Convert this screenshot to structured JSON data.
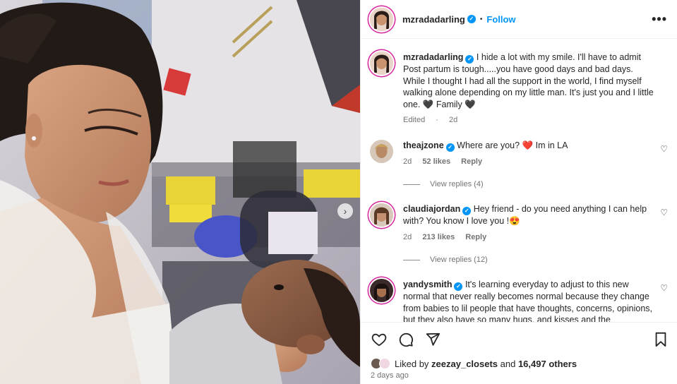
{
  "post": {
    "username": "mzradadarling",
    "follow_label": "Follow",
    "more_label": "•••",
    "dot": "•",
    "next_arrow": "›"
  },
  "caption": {
    "username": "mzradadarling",
    "text_before_heart": "I hide a lot with my smile. I'll have to admit Post partum is tough.....you have good days and bad days. While I thought I had all the support in the world, I find myself walking alone depending on my little man. It's just you and I little one.",
    "heart1": "🖤",
    "text_after": "Family",
    "heart2": "🖤",
    "edited": "Edited",
    "sep": " · ",
    "age": "2d"
  },
  "comments": [
    {
      "username": "theajzone",
      "text_a": "Where are you?",
      "emoji": "❤️",
      "text_b": "Im in LA",
      "age": "2d",
      "likes": "52 likes",
      "reply": "Reply",
      "view_replies": "View replies (4)"
    },
    {
      "username": "claudiajordan",
      "text_a": "Hey friend - do you need anything I can help with? You know I love you !",
      "emoji": "😍",
      "age": "2d",
      "likes": "213 likes",
      "reply": "Reply",
      "view_replies": "View replies (12)"
    },
    {
      "username": "yandysmith",
      "text_a": "It's learning everyday to adjust to this new normal that never really becomes normal because they change from babies to lil people that have thoughts, concerns, opinions, but they also have so many hugs, and kisses and the"
    }
  ],
  "likes": {
    "prefix": "Liked by",
    "user": "zeezay_closets",
    "mid": "and",
    "others": "16,497 others"
  },
  "time_ago": "2 days ago",
  "icons": {
    "like": "heart-icon",
    "comment": "comment-icon",
    "share": "share-icon",
    "save": "bookmark-icon",
    "heart_small": "♡"
  },
  "colors": {
    "accent": "#0095f6",
    "verified": "#0095f6",
    "text": "#262626",
    "muted": "#737373"
  }
}
